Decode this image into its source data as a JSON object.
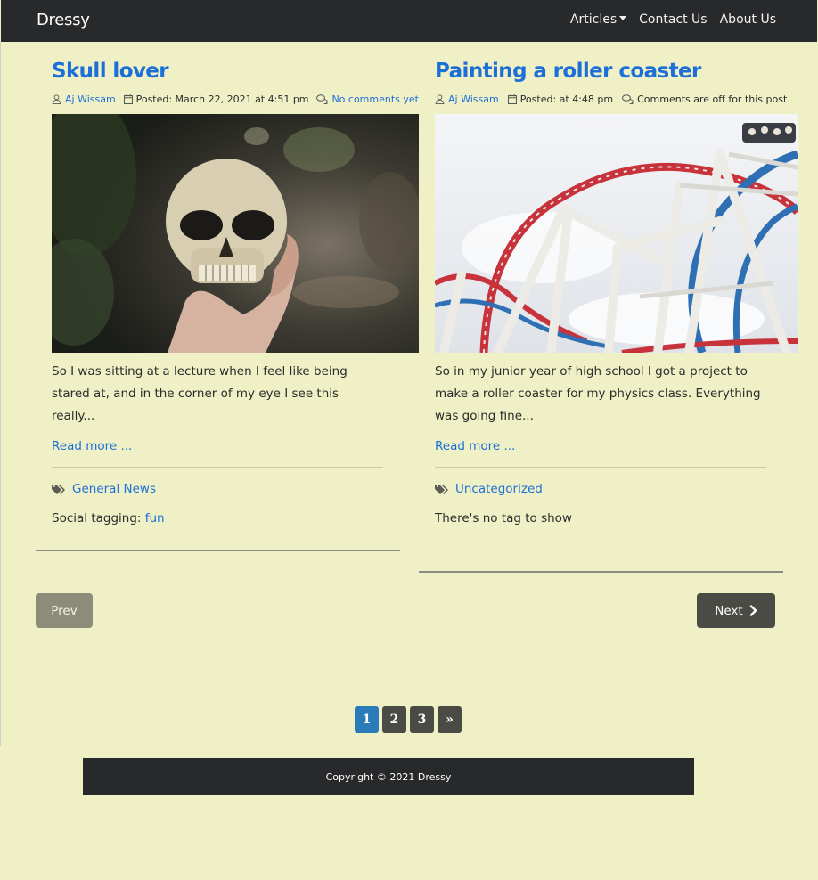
{
  "navbar": {
    "brand": "Dressy",
    "links": {
      "articles": "Articles",
      "contact": "Contact Us",
      "about": "About Us"
    }
  },
  "posts": [
    {
      "title": "Skull lover",
      "author": "Aj Wissam",
      "posted": "Posted: March 22, 2021 at 4:51 pm",
      "comments": "No comments yet",
      "image_alt": "Hand holding a human skull in a forest",
      "excerpt": "So I was sitting at a lecture when I feel like being stared at, and in the corner of my eye I see this really...",
      "read_more": "Read more ...",
      "category": "General News",
      "tags_label": "Social tagging:",
      "tag": "fun"
    },
    {
      "title": "Painting a roller coaster",
      "author": "Aj Wissam",
      "posted": "Posted: at 4:48 pm",
      "comments": "Comments are off for this post",
      "image_alt": "Red, white and blue roller coaster loops against the sky",
      "excerpt": "So in my junior year of high school I got a project to make a roller coaster for my physics class. Everything was going fine...",
      "read_more": "Read more ...",
      "category": "Uncategorized",
      "tags_text": "There's no tag to show"
    }
  ],
  "nav_buttons": {
    "prev": "Prev",
    "next": "Next"
  },
  "pagination": [
    "1",
    "2",
    "3",
    "»"
  ],
  "footer": {
    "copyright": "Copyright © 2021 Dressy"
  }
}
